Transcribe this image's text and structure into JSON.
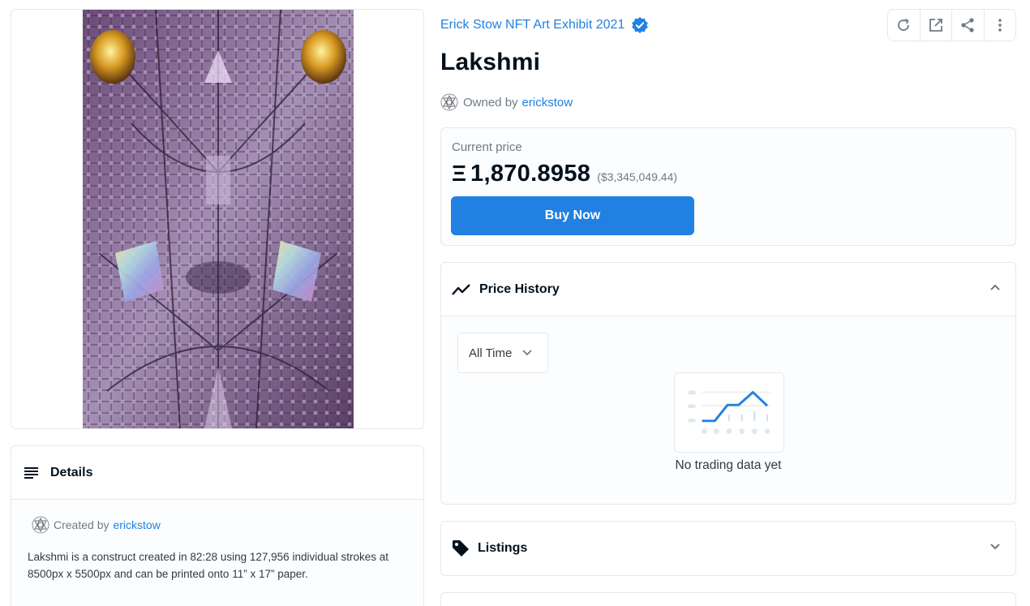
{
  "collection": {
    "name": "Erick Stow NFT Art Exhibit 2021",
    "verified_icon": "verified-badge-icon"
  },
  "nft": {
    "title": "Lakshmi"
  },
  "owner": {
    "prefix": "Owned by",
    "name": "erickstow"
  },
  "toolbar": {
    "icons": [
      "refresh-icon",
      "external-link-icon",
      "share-icon",
      "more-vertical-icon"
    ]
  },
  "price": {
    "label": "Current price",
    "currency_symbol": "Ξ",
    "value": "1,870.8958",
    "usd": "($3,345,049.44)",
    "buy_label": "Buy Now"
  },
  "price_history": {
    "title": "Price History",
    "range_selected": "All Time",
    "empty_text": "No trading data yet"
  },
  "listings": {
    "title": "Listings"
  },
  "details": {
    "title": "Details",
    "creator_prefix": "Created by",
    "creator_name": "erickstow",
    "description": "Lakshmi is a construct created in 82:28 using 127,956 individual strokes at 8500px x 5500px and can be printed onto 11” x 17” paper."
  },
  "colors": {
    "accent": "#2081e2",
    "text": "#04111d",
    "muted": "#707a83",
    "border": "#e5e8eb"
  }
}
